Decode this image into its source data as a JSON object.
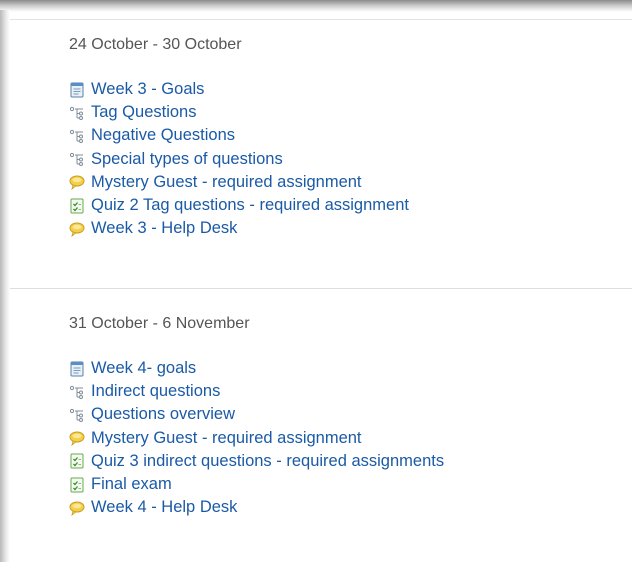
{
  "sections": [
    {
      "title": "24 October - 30 October",
      "items": [
        {
          "label": "Week 3 - Goals",
          "icon": "page-icon"
        },
        {
          "label": "Tag Questions",
          "icon": "lesson-icon"
        },
        {
          "label": "Negative Questions",
          "icon": "lesson-icon"
        },
        {
          "label": "Special types of questions",
          "icon": "lesson-icon"
        },
        {
          "label": "Mystery Guest - required assignment",
          "icon": "forum-icon"
        },
        {
          "label": "Quiz 2 Tag questions - required assignment",
          "icon": "quiz-icon"
        },
        {
          "label": "Week 3 - Help Desk",
          "icon": "forum-icon"
        }
      ]
    },
    {
      "title": "31 October - 6 November",
      "items": [
        {
          "label": "Week 4- goals",
          "icon": "page-icon"
        },
        {
          "label": "Indirect questions",
          "icon": "lesson-icon"
        },
        {
          "label": "Questions overview",
          "icon": "lesson-icon"
        },
        {
          "label": "Mystery Guest - required assignment",
          "icon": "forum-icon"
        },
        {
          "label": "Quiz 3 indirect questions - required assignments",
          "icon": "quiz-icon"
        },
        {
          "label": "Final exam",
          "icon": "quiz-icon"
        },
        {
          "label": "Week 4 - Help Desk",
          "icon": "forum-icon"
        }
      ]
    }
  ],
  "colors": {
    "link": "#1a5aa6",
    "section_title": "#555555",
    "divider": "#dedede"
  }
}
